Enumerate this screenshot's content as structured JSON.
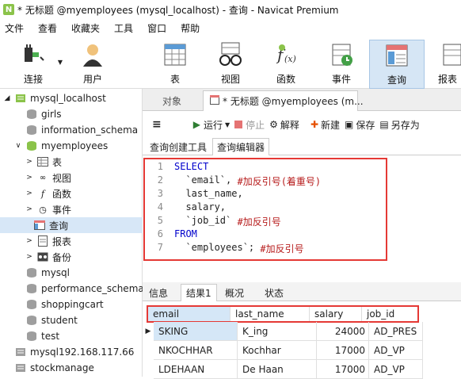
{
  "window": {
    "title": "* 无标题 @myemployees (mysql_localhost) - 查询 - Navicat Premium"
  },
  "menu": [
    "文件",
    "查看",
    "收藏夹",
    "工具",
    "窗口",
    "帮助"
  ],
  "toolbar": {
    "connect": "连接",
    "user": "用户",
    "table": "表",
    "view": "视图",
    "function": "函数",
    "event": "事件",
    "query": "查询",
    "report": "报表"
  },
  "sidebar": {
    "items": [
      {
        "label": "mysql_localhost"
      },
      {
        "label": "girls"
      },
      {
        "label": "information_schema"
      },
      {
        "label": "myemployees"
      },
      {
        "label": "表"
      },
      {
        "label": "视图"
      },
      {
        "label": "函数"
      },
      {
        "label": "事件"
      },
      {
        "label": "查询"
      },
      {
        "label": "报表"
      },
      {
        "label": "备份"
      },
      {
        "label": "mysql"
      },
      {
        "label": "performance_schema"
      },
      {
        "label": "shoppingcart"
      },
      {
        "label": "student"
      },
      {
        "label": "test"
      },
      {
        "label": "mysql192.168.117.66"
      },
      {
        "label": "stockmanage"
      }
    ]
  },
  "tabs": {
    "objects": "对象",
    "query_tab": "* 无标题 @myemployees (m..."
  },
  "query_toolbar": {
    "run": "运行",
    "stop": "停止",
    "explain": "解释",
    "new": "新建",
    "save": "保存",
    "save_as": "另存为"
  },
  "subtabs": {
    "builder": "查询创建工具",
    "editor": "查询编辑器"
  },
  "code": {
    "lines": [
      {
        "num": "1",
        "parts": [
          {
            "text": "SELECT",
            "kind": "kw"
          }
        ]
      },
      {
        "num": "2",
        "parts": [
          {
            "text": "  `email`, ",
            "kind": "plain"
          },
          {
            "text": "#加反引号(着重号)",
            "kind": "cm"
          }
        ]
      },
      {
        "num": "3",
        "parts": [
          {
            "text": "  last_name,",
            "kind": "plain"
          }
        ]
      },
      {
        "num": "4",
        "parts": [
          {
            "text": "  salary,",
            "kind": "plain"
          }
        ]
      },
      {
        "num": "5",
        "parts": [
          {
            "text": "  `job_id` ",
            "kind": "plain"
          },
          {
            "text": "#加反引号",
            "kind": "cm"
          }
        ]
      },
      {
        "num": "6",
        "parts": [
          {
            "text": "FROM",
            "kind": "kw"
          }
        ]
      },
      {
        "num": "7",
        "parts": [
          {
            "text": "  `employees`; ",
            "kind": "plain"
          },
          {
            "text": "#加反引号",
            "kind": "cm"
          }
        ]
      }
    ]
  },
  "result_tabs": {
    "info": "信息",
    "result1": "结果1",
    "profile": "概况",
    "status": "状态"
  },
  "grid": {
    "columns": [
      "email",
      "last_name",
      "salary",
      "job_id"
    ],
    "rows": [
      [
        "SKING",
        "K_ing",
        "24000",
        "AD_PRES"
      ],
      [
        "NKOCHHAR",
        "Kochhar",
        "17000",
        "AD_VP"
      ],
      [
        "LDEHAAN",
        "De Haan",
        "17000",
        "AD_VP"
      ]
    ]
  }
}
